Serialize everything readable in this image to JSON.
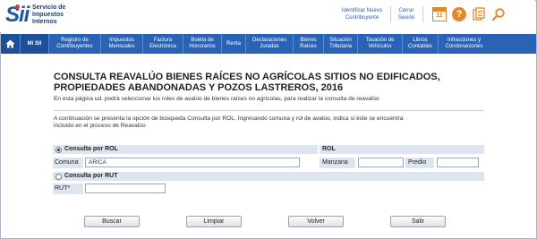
{
  "header": {
    "logo_mark": "Sii",
    "logo_text_lines": [
      "Servicio de",
      "Impuestos",
      "Internos"
    ],
    "identificar_line1": "Identificar Nuevo",
    "identificar_line2": "Contribuyente",
    "cerrar_line1": "Cerrar",
    "cerrar_line2": "Sesión",
    "calendar_day": "11",
    "help_glyph": "?",
    "icons": [
      "calendar-icon",
      "help-icon",
      "documents-icon",
      "search-icon"
    ]
  },
  "nav": {
    "home": "home-icon",
    "items": [
      {
        "line1": "Mi SII",
        "line2": ""
      },
      {
        "line1": "Registro de",
        "line2": "Contribuyentes"
      },
      {
        "line1": "Impuestos",
        "line2": "Mensuales"
      },
      {
        "line1": "Factura",
        "line2": "Electrónica"
      },
      {
        "line1": "Boleta de",
        "line2": "Honorarios"
      },
      {
        "line1": "Renta",
        "line2": ""
      },
      {
        "line1": "Declaraciones",
        "line2": "Juradas"
      },
      {
        "line1": "Bienes",
        "line2": "Raíces"
      },
      {
        "line1": "Situación",
        "line2": "Tributaria"
      },
      {
        "line1": "Tasación de",
        "line2": "Vehículos"
      },
      {
        "line1": "Libros",
        "line2": "Contables"
      },
      {
        "line1": "Infracciones y",
        "line2": "Condonaciones"
      }
    ]
  },
  "content": {
    "title_line1": "CONSULTA REAVALÚO BIENES RAÍCES NO AGRÍCOLAS SITIOS NO EDIFICADOS,",
    "title_line2": "PROPIEDADES ABANDONADAS Y POZOS LASTREROS, 2016",
    "subtitle": "En esta página ud. podrá seleccionar los roles de avalúo de bienes raíces no agrícolas, para realizar la consulta de reavalúo",
    "intro_line1": "A continuación se presenta la opción de búsqueda Consulta por ROL. Ingresando comuna y rol de avalúo, indica si éste se encuentra",
    "intro_line2": "incluido en el proceso de Reavalúo"
  },
  "form": {
    "rol_option_label": "Consulta por ROL",
    "rol_option_selected": true,
    "rol_header": "ROL",
    "comuna_label": "Comuna",
    "comuna_value": "ARICA",
    "manzana_label": "Manzana",
    "manzana_value": "",
    "predio_label": "Predio",
    "predio_value": "",
    "rut_option_label": "Consulta por RUT",
    "rut_option_selected": false,
    "rut_label": "RUT*",
    "rut_value": ""
  },
  "buttons": {
    "buscar": "Buscar",
    "limpiar": "Limpiar",
    "volver": "Volver",
    "salir": "Salir"
  },
  "colors": {
    "nav_bg": "#2a63b5",
    "brand_blue": "#1c5aa6",
    "accent_orange": "#e8862a"
  }
}
